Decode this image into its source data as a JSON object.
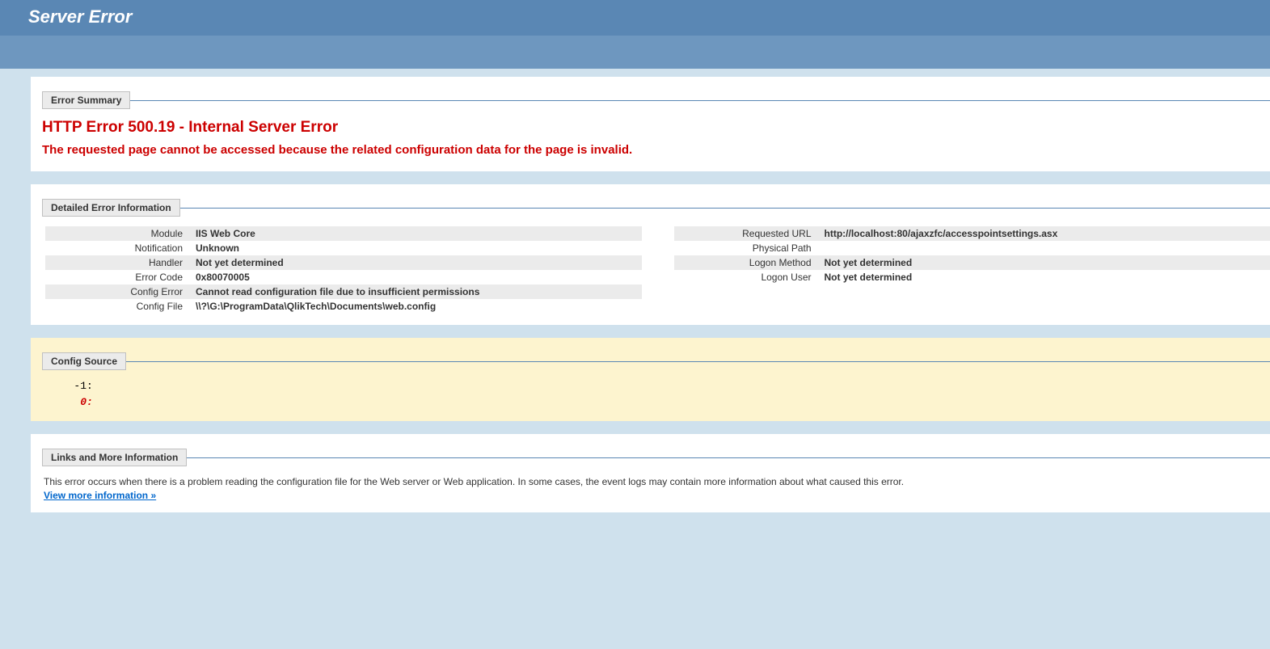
{
  "header": {
    "title": "Server Error"
  },
  "errorSummary": {
    "legend": "Error Summary",
    "title": "HTTP Error 500.19 - Internal Server Error",
    "subtitle": "The requested page cannot be accessed because the related configuration data for the page is invalid."
  },
  "detailedError": {
    "legend": "Detailed Error Information",
    "left": {
      "moduleLabel": "Module",
      "moduleValue": "IIS Web Core",
      "notificationLabel": "Notification",
      "notificationValue": "Unknown",
      "handlerLabel": "Handler",
      "handlerValue": "Not yet determined",
      "errorCodeLabel": "Error Code",
      "errorCodeValue": "0x80070005",
      "configErrorLabel": "Config Error",
      "configErrorValue": "Cannot read configuration file due to insufficient permissions",
      "configFileLabel": "Config File",
      "configFileValue": "\\\\?\\G:\\ProgramData\\QlikTech\\Documents\\web.config"
    },
    "right": {
      "requestedUrlLabel": "Requested URL",
      "requestedUrlValue": "http://localhost:80/ajaxzfc/accesspointsettings.asx",
      "physicalPathLabel": "Physical Path",
      "physicalPathValue": "",
      "logonMethodLabel": "Logon Method",
      "logonMethodValue": "Not yet determined",
      "logonUserLabel": "Logon User",
      "logonUserValue": "Not yet determined"
    }
  },
  "configSource": {
    "legend": "Config Source",
    "line1": "   -1: ",
    "line2": "    0: "
  },
  "linksMore": {
    "legend": "Links and More Information",
    "text": "This error occurs when there is a problem reading the configuration file for the Web server or Web application. In some cases, the event logs may contain more information about what caused this error.",
    "linkText": "View more information »"
  }
}
